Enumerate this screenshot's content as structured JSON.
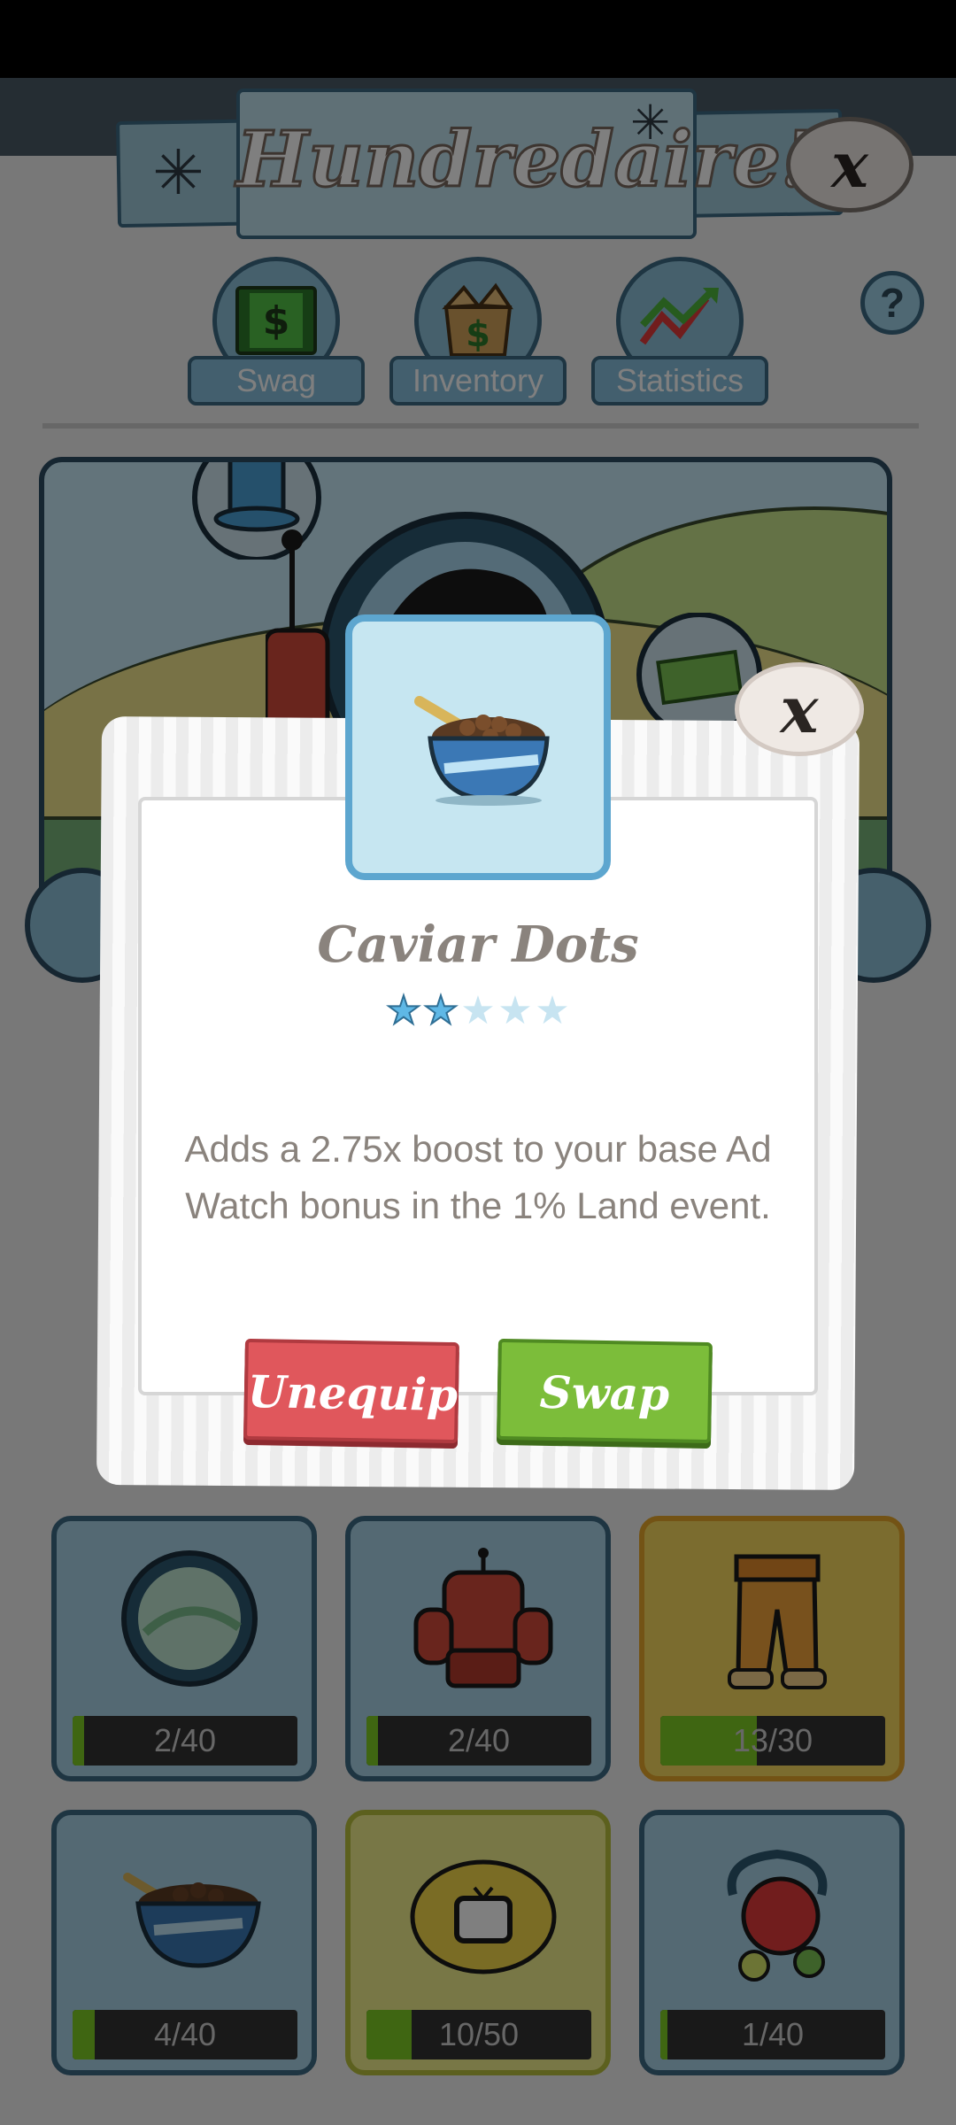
{
  "header": {
    "title": "Hundredaire!",
    "close_label": "x"
  },
  "tabs": [
    {
      "label": "Swag",
      "icon": "money-crate-icon"
    },
    {
      "label": "Inventory",
      "icon": "money-box-icon"
    },
    {
      "label": "Statistics",
      "icon": "trend-arrows-icon"
    }
  ],
  "help_label": "?",
  "slots": [
    {
      "item": "portal-mirror-icon",
      "progress_text": "2/40",
      "progress": 0.05
    },
    {
      "item": "robot-armor-icon",
      "progress_text": "2/40",
      "progress": 0.05
    },
    {
      "item": "golden-pants-icon",
      "progress_text": "13/30",
      "progress": 0.43
    },
    {
      "item": "caviar-bowl-icon",
      "progress_text": "4/40",
      "progress": 0.1
    },
    {
      "item": "tv-coin-icon",
      "progress_text": "10/50",
      "progress": 0.2
    },
    {
      "item": "stop-sign-trinket-icon",
      "progress_text": "1/40",
      "progress": 0.03
    }
  ],
  "modal": {
    "close_label": "x",
    "item_icon": "caviar-bowl-icon",
    "item_name": "Caviar Dots",
    "rating": 2,
    "rating_max": 5,
    "description": "Adds a 2.75x boost to your base Ad Watch bonus in the 1% Land event.",
    "unequip_label": "Unequip",
    "swap_label": "Swap"
  },
  "colors": {
    "accent_blue": "#5da6cf",
    "unequip_red": "#e0575c",
    "swap_green": "#7cbd3a",
    "progress_green": "#7fcc24"
  }
}
